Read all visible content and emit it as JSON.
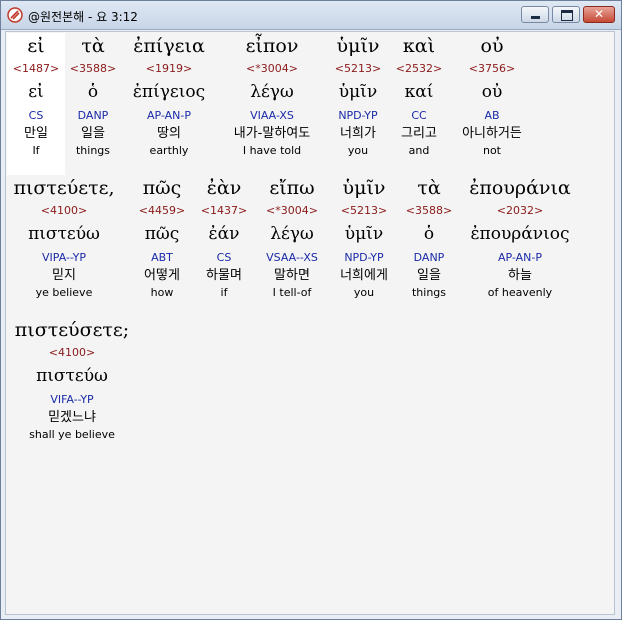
{
  "window": {
    "title": "@원전본해 - 요 3:12"
  },
  "verse_rows": [
    {
      "words": [
        {
          "greek": "εἰ",
          "strong": "<1487>",
          "lemma": "εἰ",
          "parse": "CS",
          "korean": "만일",
          "english": "If"
        },
        {
          "greek": "τὰ",
          "strong": "<3588>",
          "lemma": "ὁ",
          "parse": "DANP",
          "korean": "일을",
          "english": "things"
        },
        {
          "greek": "ἐπίγεια",
          "strong": "<1919>",
          "lemma": "ἐπίγειος",
          "parse": "AP-AN-P",
          "korean": "땅의",
          "english": "earthly"
        },
        {
          "greek": "εἶπον",
          "strong": "<*3004>",
          "lemma": "λέγω",
          "parse": "VIAA-XS",
          "korean": "내가-말하여도",
          "english": "I have told"
        },
        {
          "greek": "ὑμῖν",
          "strong": "<5213>",
          "lemma": "ὑμῖν",
          "parse": "NPD-YP",
          "korean": "너희가",
          "english": "you"
        },
        {
          "greek": "καὶ",
          "strong": "<2532>",
          "lemma": "καί",
          "parse": "CC",
          "korean": "그리고",
          "english": "and"
        },
        {
          "greek": "οὐ",
          "strong": "<3756>",
          "lemma": "οὐ",
          "parse": "AB",
          "korean": "아니하거든",
          "english": "not"
        }
      ]
    },
    {
      "words": [
        {
          "greek": "πιστεύετε,",
          "strong": "<4100>",
          "lemma": "πιστεύω",
          "parse": "VIPA--YP",
          "korean": "믿지",
          "english": "ye believe"
        },
        {
          "greek": "πῶς",
          "strong": "<4459>",
          "lemma": "πῶς",
          "parse": "ABT",
          "korean": "어떻게",
          "english": "how"
        },
        {
          "greek": "ἐὰν",
          "strong": "<1437>",
          "lemma": "ἐάν",
          "parse": "CS",
          "korean": "하물며",
          "english": "if"
        },
        {
          "greek": "εἴπω",
          "strong": "<*3004>",
          "lemma": "λέγω",
          "parse": "VSAA--XS",
          "korean": "말하면",
          "english": "I tell-of"
        },
        {
          "greek": "ὑμῖν",
          "strong": "<5213>",
          "lemma": "ὑμῖν",
          "parse": "NPD-YP",
          "korean": "너희에게",
          "english": "you"
        },
        {
          "greek": "τὰ",
          "strong": "<3588>",
          "lemma": "ὁ",
          "parse": "DANP",
          "korean": "일을",
          "english": "things"
        },
        {
          "greek": "ἐπουράνια",
          "strong": "<2032>",
          "lemma": "ἐπουράνιος",
          "parse": "AP-AN-P",
          "korean": "하늘",
          "english": "of heavenly"
        }
      ]
    },
    {
      "words": [
        {
          "greek": "πιστεύσετε;",
          "strong": "<4100>",
          "lemma": "πιστεύω",
          "parse": "VIFA--YP",
          "korean": "믿겠느냐",
          "english": "shall ye believe"
        }
      ]
    }
  ],
  "colors": {
    "strong": "#8b1a1a",
    "parse": "#1a2aa8",
    "background": "#f4f4f4",
    "highlight": "#ffffff"
  }
}
